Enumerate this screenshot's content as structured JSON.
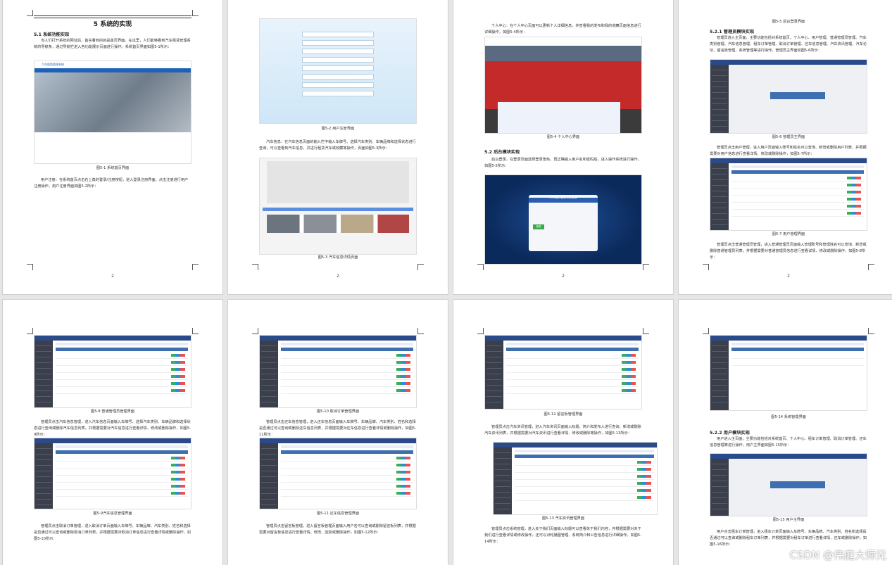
{
  "pages": [
    {
      "number": "2",
      "heading": "5 系统的实现",
      "section": "5.1 系统功能实现",
      "para1": "当人们打开系统的网址后，首先看到的就是首页界面。在这里，人们能够看到汽车租赁管理系统的导航条，通过导航栏进入各功能展示页面进行操作。系统首页界面如图5-1所示：",
      "caption1": "图5-1 系统首页界面",
      "para2": "用户注册：在系统首页点击右上角的登录/注册按钮，进入登录注册界面，点击注册进行用户注册操作，用户注册界面如图5-2所示："
    },
    {
      "number": "2",
      "caption1": "图5-2 用户注册界面",
      "para1": "汽车信息：在汽车信息页面的输入栏中输入车牌号、选择汽车类别、车辆品牌和选择状态进行查询，可以查看到汽车信息，并进行租赁汽车或收藏等操作，页面如图5-3所示：",
      "caption2": "图5-3 汽车信息详情页面"
    },
    {
      "number": "2",
      "para1": "个人中心：在个人中心页面可以更新个人详细信息，并查看我的发布和我的收藏页面信息进行详细操作，如图5-4所示：",
      "caption1": "图5-4 个人中心界面",
      "section": "5.2 后台模块实现",
      "para2": "后台登录，在登录页面选择登录角色，再正确输入用户名和密码后，进入操作系统进行操作，如图5-5所示："
    },
    {
      "number": "2",
      "caption0": "图5-5 后台登录界面",
      "section": "5.2.1 管理员模块实现",
      "para1": "管理员进入主页面，主要功能包括对系统首页、个人中心、用户管理、普通管理员管理、汽车类别管理、汽车信息管理、租车订单管理、取消订单管理、还车信息管理、汽车资讯管理、汽车论坛、留言板管理、系统管理等进行操作。管理员主界面如图5-6所示：",
      "caption1": "图5-6 管理员主界面",
      "para2": "管理员点击用户管理，进入用户页面输入账号和姓名可以查询、新增或删除用户列表，并根据需要对用户信息进行查看详情、修改或删除操作，如图5-7所示：",
      "caption2": "图5-7 用户管理界面",
      "para3": "管理员点击普通管理员管理，进入普通管理员页面输入管理账号和管理姓名可以查询、新增或删除普通管理员列表，并根据需要对普通管理员信息进行查看详情、修改或删除操作，如图5-8所示："
    },
    {
      "caption1": "图5-8 普通管理员管理界面",
      "para1": "管理员点击汽车信息管理，进入汽车信息页面输入车牌号、选择汽车类别、车辆品牌和选择状态进行查询或删除汽车信息列表，并根据需要对汽车信息进行查看详情、修改或删除操作，如图5-9所示：",
      "caption2": "图5-9汽车信息管理界面",
      "para2": "管理员点击取消订单管理，进入取消订单页面输入车牌号、车辆品牌、汽车类别、姓名和选择是否通过可以查询或删除取消订单列表，并根据需要对取消订单信息进行查看详情或删除操作，如图5-10所示："
    },
    {
      "caption1": "图5-10 取消订单管理界面",
      "para1": "管理员点击还车信息管理，进入还车信息页面输入车牌号、车辆品牌、汽车类别、姓名和选择是否通过可以查询或删除还车信息列表，并根据需要对还车信息进行查看详情或删除操作，如图5-11所示：",
      "caption2": "图5-11 还车信息管理界面",
      "para2": "管理员点击留言板管理，进入留言板管理页面输入用户名可以查询或删除留言板列表，并根据需要对留言板信息进行查看详情、修改、回复或删除操作，如图5-12所示："
    },
    {
      "caption1": "图5-12 留言板管理界面",
      "para1": "管理员点击汽车资讯管理，进入汽车资讯页面输入标题、简介和发布人进行查询、新增或删除汽车资讯列表，并根据需要对汽车资讯进行查看详情、修改或删除等操作，如图5-13所示：",
      "caption2": "图5-13 汽车资讯管理界面",
      "para2": "管理员点击系统管理，进入关于我们页面输入标题可以查看关于我们内容，并根据需要对关于我们进行查看详情或修改操作，还可以对轮播图管理、系统简介和公告信息进行详细操作，如图5-14所示："
    },
    {
      "caption1": "图5-14 系统管理界面",
      "section": "5.2.2 用户模块实现",
      "para1": "用户进入主页面，主要功能包括对系统首页、个人中心、租车订单管理、取消订单管理、还车信息管理等进行操作，用户主界面如图5-15所示：",
      "caption2": "图5-15 用户主界面",
      "para2": "用户点击租车订单管理，进入租车订单页面输入车牌号、车辆品牌、汽车类别、姓名和选择是否通过可以查询或删除租车订单列表，并根据需要对租车订单进行查看详情、还车或删除操作，如图5-16所示："
    }
  ],
  "ui": {
    "site_title": "汽车租赁管理系统",
    "admin_title": "汽车租赁管理系统",
    "welcome": "欢迎使用 汽车租赁管理系统",
    "login_title": "汽车租赁管理系统登录",
    "login_button": "登录"
  },
  "watermark": "CSDN @伟庭大师兄"
}
